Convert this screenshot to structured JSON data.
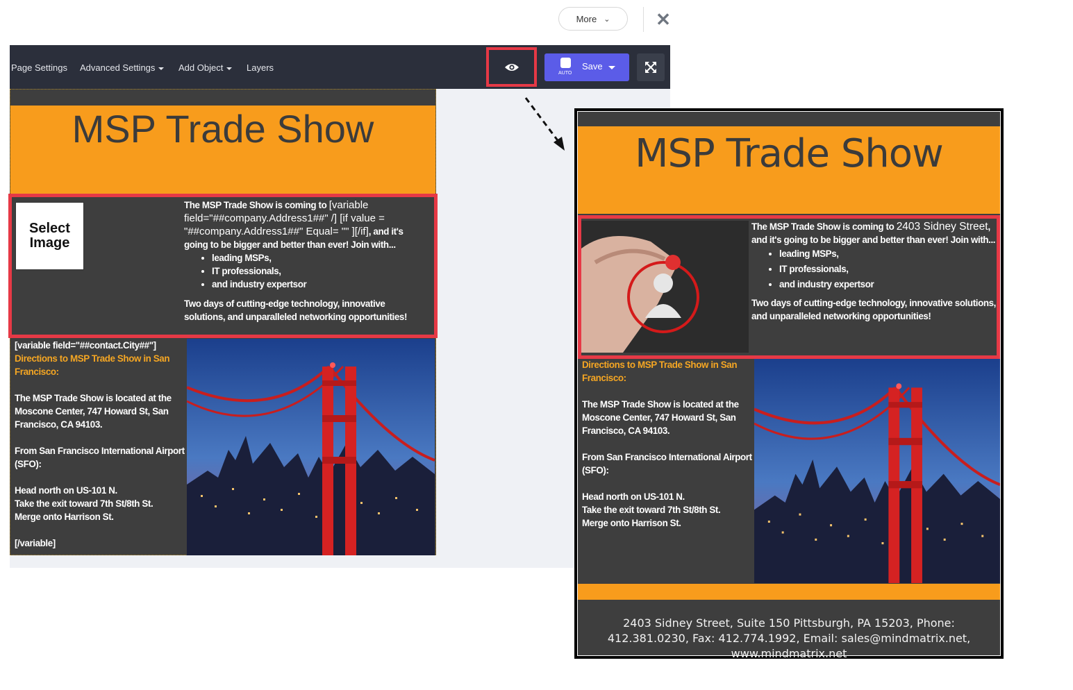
{
  "header": {
    "more_label": "More",
    "close_icon": "close-icon"
  },
  "toolbar": {
    "items": [
      "Page Settings",
      "Advanced Settings",
      "Add Object",
      "Layers"
    ],
    "save_label": "Save",
    "save_auto": "AUTO"
  },
  "editor": {
    "title": "MSP Trade Show",
    "select_image_line1": "Select",
    "select_image_line2": "Image",
    "intro_lead": "The MSP Trade Show is coming to ",
    "intro_var": "[variable field=\"##company.Address1##\" /] [if value = \"##company.Address1##\" Equal= \"\" ][/if]",
    "intro_tail": ", and it's going to be bigger and better than ever! Join with...",
    "bullets": [
      "leading MSPs,",
      "IT professionals,",
      "and industry expertsor"
    ],
    "closing": "Two days of cutting-edge technology, innovative solutions, and unparalleled networking opportunities!",
    "var_open": "[variable field=\"##contact.City##\"]",
    "directions": "Directions to MSP Trade Show in San Francisco:",
    "location": "The MSP Trade Show is located at the Moscone Center, 747 Howard St, San Francisco, CA 94103.",
    "from_airport": "From San Francisco International Airport (SFO):",
    "step1": "Head north on US-101 N.",
    "step2": "Take the exit toward 7th St/8th St.",
    "step3": "Merge onto Harrison St.",
    "var_close": "[/variable]"
  },
  "preview": {
    "title": "MSP Trade Show",
    "intro_lead": "The MSP Trade Show is coming to ",
    "intro_address": "2403 Sidney Street",
    "intro_tail": ", and it's going to be bigger and better than ever! Join with...",
    "bullets": [
      "leading MSPs,",
      "IT professionals,",
      "and industry expertsor"
    ],
    "closing": "Two days of cutting-edge technology, innovative solutions, and unparalleled networking opportunities!",
    "directions": "Directions to MSP Trade Show in San Francisco:",
    "location": "The MSP Trade Show is located at the Moscone Center, 747 Howard St, San Francisco, CA 94103.",
    "from_airport": "From San Francisco International Airport (SFO):",
    "step1": "Head north on US-101 N.",
    "step2": "Take the exit toward 7th St/8th St.",
    "step3": "Merge onto Harrison St.",
    "footer": "2403 Sidney Street, Suite 150 Pittsburgh, PA 15203, Phone: 412.381.0230, Fax: 412.774.1992, Email: sales@mindmatrix.net, www.mindmatrix.net"
  },
  "colors": {
    "toolbar": "#2b2f3b",
    "save": "#5b5ce8",
    "highlight": "#e63946",
    "orange": "#f89c1c",
    "page": "#3e3e3e"
  }
}
